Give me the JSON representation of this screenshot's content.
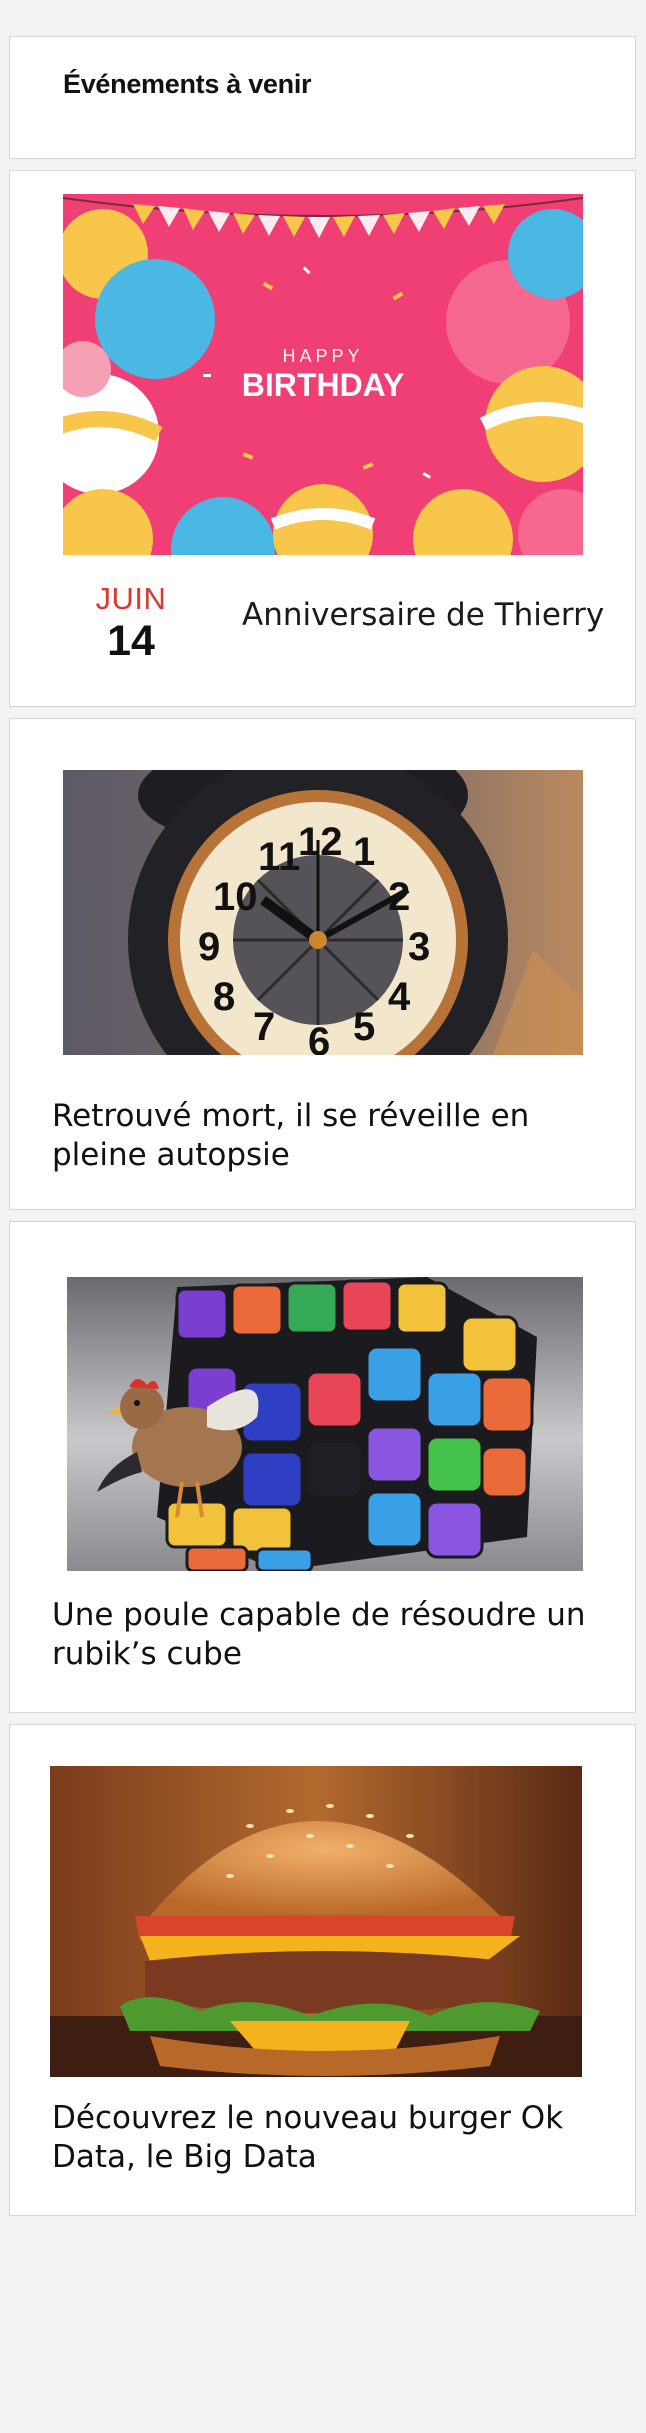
{
  "events": {
    "section_title": "Événements à venir",
    "items": [
      {
        "image_text_small": "HAPPY",
        "image_text_large": "BIRTHDAY",
        "month": "JUIN",
        "day": "14",
        "name": "Anniversaire de Thierry"
      }
    ]
  },
  "articles": [
    {
      "title": "Retrouvé mort, il se réveille en pleine autopsie",
      "image": "alarm-clock"
    },
    {
      "title": "Une poule capable de résoudre un rubik’s cube",
      "image": "chicken-rubiks-cube"
    },
    {
      "title": "Découvrez le nouveau burger Ok Data, le Big Data",
      "image": "burger"
    }
  ],
  "colors": {
    "page_bg": "#f3f3f3",
    "card_bg": "#ffffff",
    "card_border": "#d6d6d6",
    "month_accent": "#d73a2f",
    "birthday_bg": "#ef3f74"
  }
}
